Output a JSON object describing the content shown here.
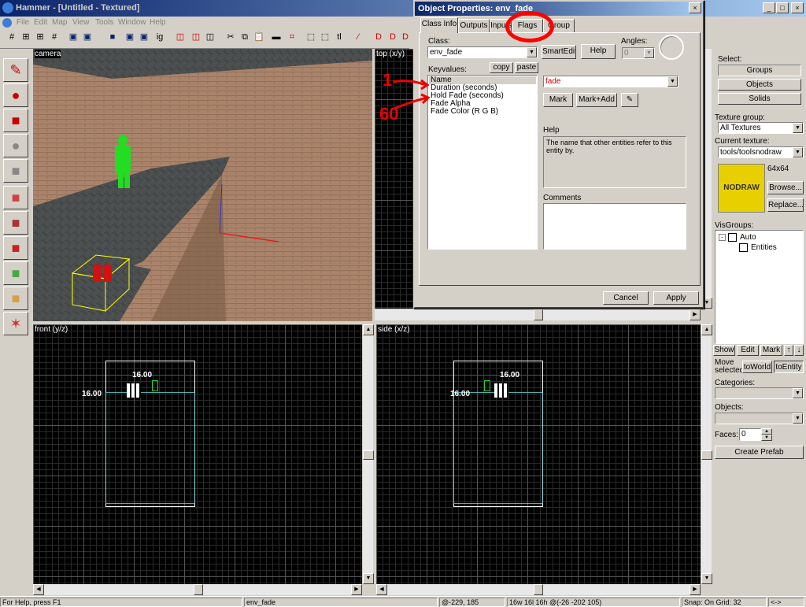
{
  "app": {
    "title": "Hammer - [Untitled - Textured]"
  },
  "menu": [
    "File",
    "Edit",
    "Map",
    "View",
    "Tools",
    "Window",
    "Help"
  ],
  "viewports": {
    "camera": "camera",
    "top": "top (x/y)",
    "front": "front (y/z)",
    "side": "side (x/z)",
    "front_dim_w": "16.00",
    "front_dim_h": "16.00",
    "side_dim_w": "16.00",
    "side_dim_h": "16.00"
  },
  "dialog": {
    "title": "Object Properties: env_fade",
    "tabs": [
      "Class Info",
      "Outputs",
      "Inputs",
      "Flags",
      "Group"
    ],
    "class_label": "Class:",
    "class_value": "env_fade",
    "smartedit": "SmartEdit",
    "help": "Help",
    "angles_label": "Angles:",
    "angles_value": "0",
    "keyvalues_label": "Keyvalues:",
    "copy": "copy",
    "paste": "paste",
    "keyvalues": [
      "Name",
      "Duration (seconds)",
      "Hold Fade (seconds)",
      "Fade Alpha",
      "Fade Color (R G B)"
    ],
    "value_field": "fade",
    "mark": "Mark",
    "mark_add": "Mark+Add",
    "help_label": "Help",
    "help_text": "The name that other entities refer to this entity by.",
    "comments_label": "Comments",
    "cancel": "Cancel",
    "apply": "Apply"
  },
  "annotations": {
    "one": "1",
    "sixty": "60"
  },
  "right": {
    "select_label": "Select:",
    "groups": "Groups",
    "objects": "Objects",
    "solids": "Solids",
    "texture_group_label": "Texture group:",
    "texture_group": "All Textures",
    "current_texture_label": "Current texture:",
    "current_texture": "tools/toolsnodraw",
    "texture_size": "64x64",
    "texture_name": "NODRAW",
    "browse": "Browse...",
    "replace": "Replace...",
    "visgroups_label": "VisGroups:",
    "visgroup_auto": "Auto",
    "visgroup_entities": "Entities",
    "show": "Show",
    "edit": "Edit",
    "mark": "Mark",
    "move_selected": "Move selected:",
    "to_world": "toWorld",
    "to_entity": "toEntity",
    "categories_label": "Categories:",
    "objects_label": "Objects:",
    "faces_label": "Faces:",
    "faces_value": "0",
    "create_prefab": "Create Prefab"
  },
  "status": {
    "help": "For Help, press F1",
    "entity": "env_fade",
    "coords": "@-229, 185",
    "size": "16w 16l 16h @(-26 -202 105)",
    "snap": "Snap: On Grid: 32",
    "extra": "<->"
  },
  "colors": {
    "title": "#0a246a",
    "annotation": "#e00000",
    "nodraw": "#e8d000"
  }
}
